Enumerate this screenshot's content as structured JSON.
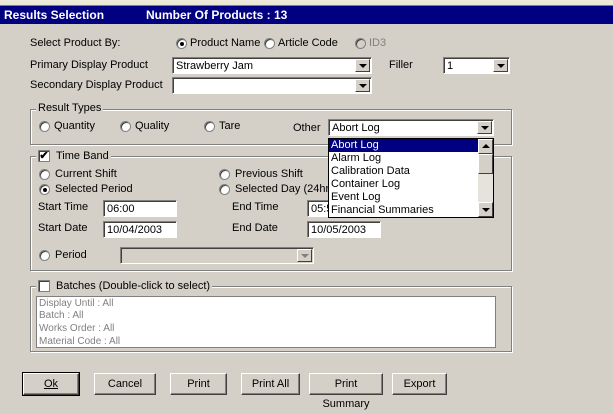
{
  "title": {
    "label": "Results Selection",
    "count": "Number Of Products : 13"
  },
  "product": {
    "select_by_label": "Select Product By:",
    "options": [
      "Product Name",
      "Article Code",
      "ID3"
    ],
    "primary_label": "Primary Display Product",
    "primary_value": "Strawberry Jam",
    "secondary_label": "Secondary Display Product",
    "secondary_value": "",
    "filler_label": "Filler",
    "filler_value": "1"
  },
  "result_types": {
    "legend": "Result Types",
    "options": [
      "Quantity",
      "Quality",
      "Tare"
    ],
    "other_label": "Other",
    "other_value": "Abort Log",
    "list": [
      "Abort Log",
      "Alarm Log",
      "Calibration Data",
      "Container Log",
      "Event Log",
      "Financial Summaries"
    ]
  },
  "time_band": {
    "legend": "Time Band",
    "checked": "✔",
    "current_shift": "Current Shift",
    "previous_shift": "Previous Shift",
    "selected_period": "Selected Period",
    "selected_day": "Selected Day (24hrs",
    "start_time_label": "Start Time",
    "start_time": "06:00",
    "end_time_label": "End Time",
    "end_time": "05:5",
    "start_date_label": "Start Date",
    "start_date": "10/04/2003",
    "end_date_label": "End Date",
    "end_date": "10/05/2003",
    "period_label": "Period"
  },
  "batches": {
    "legend": "Batches (Double-click to select)",
    "lines": [
      "Display Until : All",
      "Batch : All",
      "Works Order : All",
      "Material Code : All"
    ]
  },
  "buttons": {
    "ok": "Ok",
    "cancel": "Cancel",
    "print": "Print",
    "print_all": "Print All",
    "print_summary": "Print Summary",
    "export": "Export"
  }
}
